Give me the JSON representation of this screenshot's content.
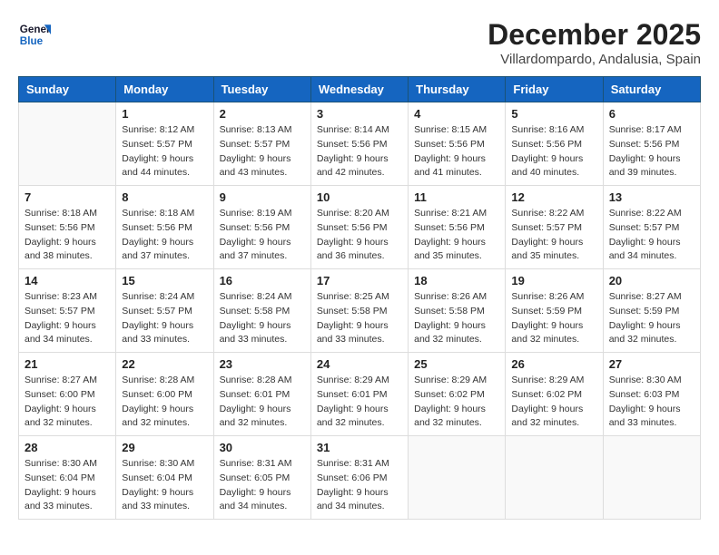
{
  "logo": {
    "line1": "General",
    "line2": "Blue"
  },
  "title": "December 2025",
  "subtitle": "Villardompardo, Andalusia, Spain",
  "weekdays": [
    "Sunday",
    "Monday",
    "Tuesday",
    "Wednesday",
    "Thursday",
    "Friday",
    "Saturday"
  ],
  "weeks": [
    [
      {
        "day": "",
        "info": ""
      },
      {
        "day": "1",
        "info": "Sunrise: 8:12 AM\nSunset: 5:57 PM\nDaylight: 9 hours\nand 44 minutes."
      },
      {
        "day": "2",
        "info": "Sunrise: 8:13 AM\nSunset: 5:57 PM\nDaylight: 9 hours\nand 43 minutes."
      },
      {
        "day": "3",
        "info": "Sunrise: 8:14 AM\nSunset: 5:56 PM\nDaylight: 9 hours\nand 42 minutes."
      },
      {
        "day": "4",
        "info": "Sunrise: 8:15 AM\nSunset: 5:56 PM\nDaylight: 9 hours\nand 41 minutes."
      },
      {
        "day": "5",
        "info": "Sunrise: 8:16 AM\nSunset: 5:56 PM\nDaylight: 9 hours\nand 40 minutes."
      },
      {
        "day": "6",
        "info": "Sunrise: 8:17 AM\nSunset: 5:56 PM\nDaylight: 9 hours\nand 39 minutes."
      }
    ],
    [
      {
        "day": "7",
        "info": "Sunrise: 8:18 AM\nSunset: 5:56 PM\nDaylight: 9 hours\nand 38 minutes."
      },
      {
        "day": "8",
        "info": "Sunrise: 8:18 AM\nSunset: 5:56 PM\nDaylight: 9 hours\nand 37 minutes."
      },
      {
        "day": "9",
        "info": "Sunrise: 8:19 AM\nSunset: 5:56 PM\nDaylight: 9 hours\nand 37 minutes."
      },
      {
        "day": "10",
        "info": "Sunrise: 8:20 AM\nSunset: 5:56 PM\nDaylight: 9 hours\nand 36 minutes."
      },
      {
        "day": "11",
        "info": "Sunrise: 8:21 AM\nSunset: 5:56 PM\nDaylight: 9 hours\nand 35 minutes."
      },
      {
        "day": "12",
        "info": "Sunrise: 8:22 AM\nSunset: 5:57 PM\nDaylight: 9 hours\nand 35 minutes."
      },
      {
        "day": "13",
        "info": "Sunrise: 8:22 AM\nSunset: 5:57 PM\nDaylight: 9 hours\nand 34 minutes."
      }
    ],
    [
      {
        "day": "14",
        "info": "Sunrise: 8:23 AM\nSunset: 5:57 PM\nDaylight: 9 hours\nand 34 minutes."
      },
      {
        "day": "15",
        "info": "Sunrise: 8:24 AM\nSunset: 5:57 PM\nDaylight: 9 hours\nand 33 minutes."
      },
      {
        "day": "16",
        "info": "Sunrise: 8:24 AM\nSunset: 5:58 PM\nDaylight: 9 hours\nand 33 minutes."
      },
      {
        "day": "17",
        "info": "Sunrise: 8:25 AM\nSunset: 5:58 PM\nDaylight: 9 hours\nand 33 minutes."
      },
      {
        "day": "18",
        "info": "Sunrise: 8:26 AM\nSunset: 5:58 PM\nDaylight: 9 hours\nand 32 minutes."
      },
      {
        "day": "19",
        "info": "Sunrise: 8:26 AM\nSunset: 5:59 PM\nDaylight: 9 hours\nand 32 minutes."
      },
      {
        "day": "20",
        "info": "Sunrise: 8:27 AM\nSunset: 5:59 PM\nDaylight: 9 hours\nand 32 minutes."
      }
    ],
    [
      {
        "day": "21",
        "info": "Sunrise: 8:27 AM\nSunset: 6:00 PM\nDaylight: 9 hours\nand 32 minutes."
      },
      {
        "day": "22",
        "info": "Sunrise: 8:28 AM\nSunset: 6:00 PM\nDaylight: 9 hours\nand 32 minutes."
      },
      {
        "day": "23",
        "info": "Sunrise: 8:28 AM\nSunset: 6:01 PM\nDaylight: 9 hours\nand 32 minutes."
      },
      {
        "day": "24",
        "info": "Sunrise: 8:29 AM\nSunset: 6:01 PM\nDaylight: 9 hours\nand 32 minutes."
      },
      {
        "day": "25",
        "info": "Sunrise: 8:29 AM\nSunset: 6:02 PM\nDaylight: 9 hours\nand 32 minutes."
      },
      {
        "day": "26",
        "info": "Sunrise: 8:29 AM\nSunset: 6:02 PM\nDaylight: 9 hours\nand 32 minutes."
      },
      {
        "day": "27",
        "info": "Sunrise: 8:30 AM\nSunset: 6:03 PM\nDaylight: 9 hours\nand 33 minutes."
      }
    ],
    [
      {
        "day": "28",
        "info": "Sunrise: 8:30 AM\nSunset: 6:04 PM\nDaylight: 9 hours\nand 33 minutes."
      },
      {
        "day": "29",
        "info": "Sunrise: 8:30 AM\nSunset: 6:04 PM\nDaylight: 9 hours\nand 33 minutes."
      },
      {
        "day": "30",
        "info": "Sunrise: 8:31 AM\nSunset: 6:05 PM\nDaylight: 9 hours\nand 34 minutes."
      },
      {
        "day": "31",
        "info": "Sunrise: 8:31 AM\nSunset: 6:06 PM\nDaylight: 9 hours\nand 34 minutes."
      },
      {
        "day": "",
        "info": ""
      },
      {
        "day": "",
        "info": ""
      },
      {
        "day": "",
        "info": ""
      }
    ]
  ]
}
